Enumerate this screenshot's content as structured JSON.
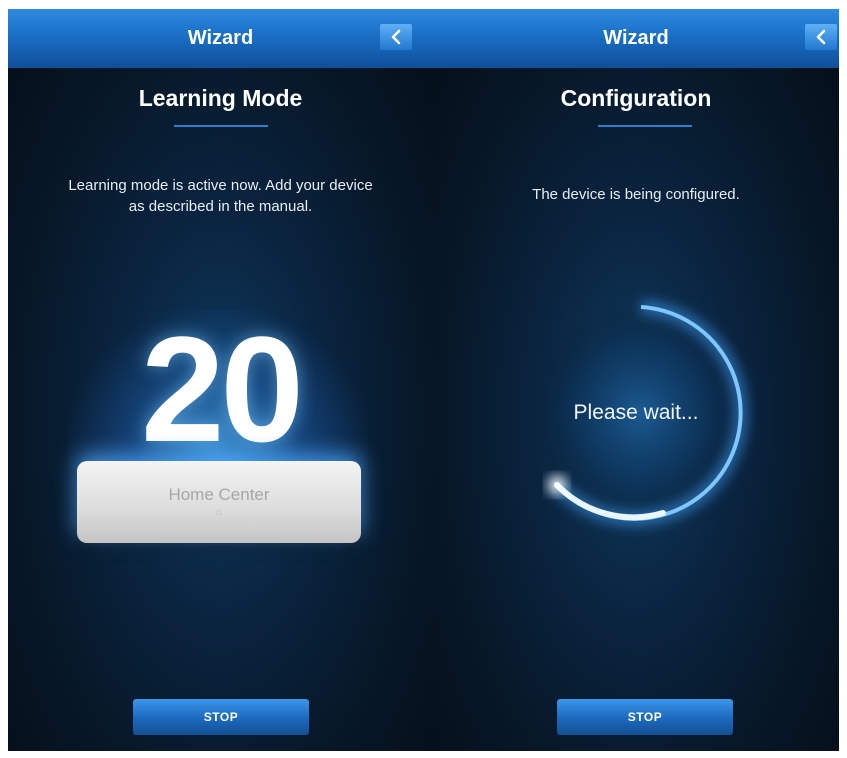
{
  "left_screen": {
    "title": "Wizard",
    "heading": "Learning Mode",
    "description_line1": "Learning mode is active now. Add your device",
    "description_line2": "as described in the manual.",
    "countdown": "20",
    "device_label": "Home Center",
    "stop_label": "STOP",
    "back_icon": "chevron-left-icon"
  },
  "right_screen": {
    "title": "Wizard",
    "heading": "Configuration",
    "description": "The device is being configured.",
    "wait_text": "Please wait...",
    "stop_label": "STOP",
    "back_icon": "chevron-left-icon"
  },
  "colors": {
    "titlebar": "#1a6fc6",
    "background": "#071829",
    "accent": "#2d7fd0",
    "button": "#1d6cc2"
  }
}
